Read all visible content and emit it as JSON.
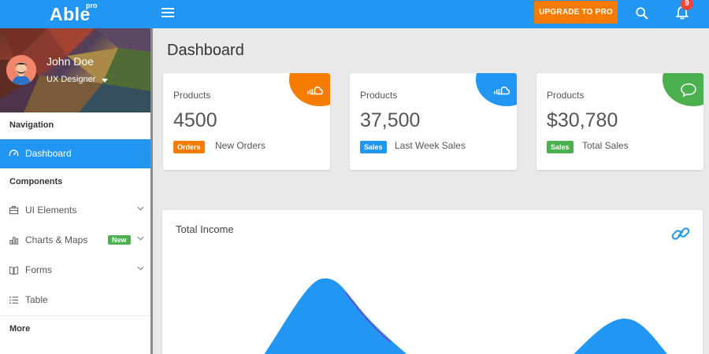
{
  "header": {
    "brand": "Able",
    "brand_sup": "pro",
    "upgrade_label": "UPGRADE TO PRO",
    "notification_count": "9",
    "icons": [
      "menu-icon",
      "search-icon",
      "bell-icon"
    ]
  },
  "profile": {
    "name": "John Doe",
    "role": "UX Designer"
  },
  "sidebar": {
    "caption_navigation": "Navigation",
    "caption_components": "Components",
    "caption_more": "More",
    "items": [
      {
        "label": "Dashboard",
        "icon": "dashboard-icon",
        "active": true
      },
      {
        "label": "UI Elements",
        "icon": "ui-elements-icon"
      },
      {
        "label": "Charts & Maps",
        "icon": "chart-icon",
        "badge": "New"
      },
      {
        "label": "Forms",
        "icon": "forms-icon"
      },
      {
        "label": "Table",
        "icon": "table-icon"
      }
    ]
  },
  "main": {
    "page_title": "Dashboard",
    "cards": [
      {
        "label": "Products",
        "value": "4500",
        "tag": "Orders",
        "note": "New Orders",
        "color": "#f57c00",
        "icon": "cloud-icon"
      },
      {
        "label": "Products",
        "value": "37,500",
        "tag": "Sales",
        "note": "Last Week Sales",
        "color": "#2196f3",
        "icon": "cloud-icon"
      },
      {
        "label": "Products",
        "value": "$30,780",
        "tag": "Sales",
        "note": "Total Sales",
        "color": "#4caf50",
        "icon": "chat-icon"
      }
    ],
    "income": {
      "title": "Total Income",
      "icon": "link-icon"
    }
  },
  "colors": {
    "primary": "#2196f3",
    "warning": "#f57c00",
    "success": "#4caf50",
    "danger": "#f44336"
  }
}
